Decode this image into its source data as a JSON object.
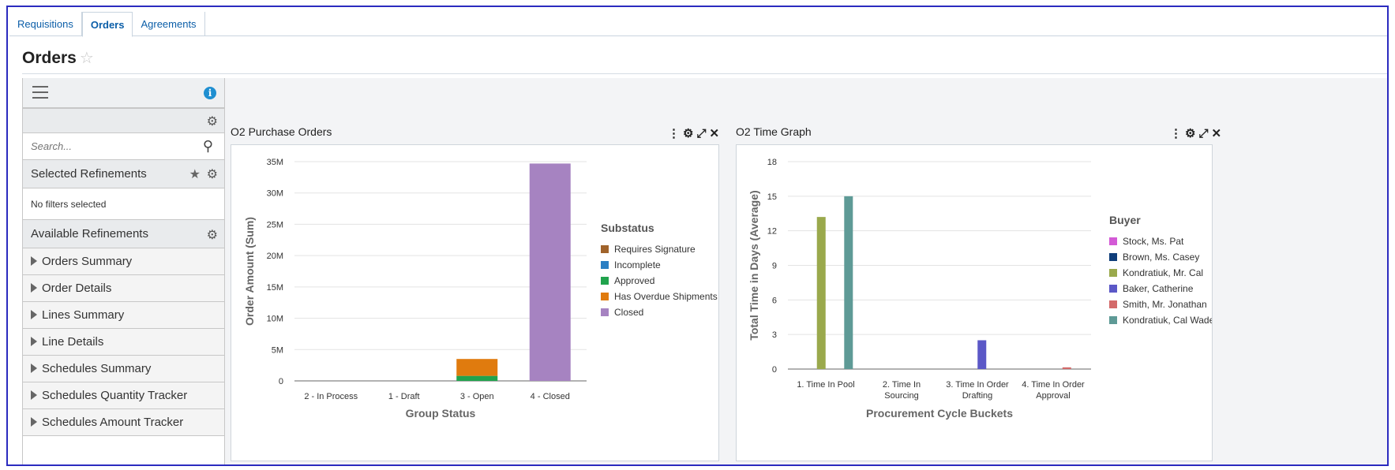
{
  "tabs": [
    "Requisitions",
    "Orders",
    "Agreements"
  ],
  "page": {
    "title": "Orders"
  },
  "sidebar": {
    "search_placeholder": "Search...",
    "selected_refinements": "Selected Refinements",
    "no_filters": "No filters selected",
    "available_refinements": "Available Refinements",
    "items": [
      "Orders Summary",
      "Order Details",
      "Lines Summary",
      "Line Details",
      "Schedules Summary",
      "Schedules Quantity Tracker",
      "Schedules Amount Tracker"
    ]
  },
  "panels": {
    "po": {
      "title": "O2 Purchase Orders"
    },
    "time": {
      "title": "O2 Time Graph"
    }
  },
  "chart_data": [
    {
      "type": "bar",
      "stacked": true,
      "title": "O2 Purchase Orders",
      "xlabel": "Group Status",
      "ylabel": "Order Amount (Sum)",
      "ylim": [
        0,
        35000000
      ],
      "yticks": [
        "0",
        "5M",
        "10M",
        "15M",
        "20M",
        "25M",
        "30M",
        "35M"
      ],
      "categories": [
        "2 - In Process",
        "1 - Draft",
        "3 - Open",
        "4 - Closed"
      ],
      "legend_title": "Substatus",
      "legend_position": "right",
      "series": [
        {
          "name": "Requires Signature",
          "color": "#a0632b",
          "values": [
            0,
            0,
            0,
            0
          ]
        },
        {
          "name": "Incomplete",
          "color": "#2a7fc3",
          "values": [
            0,
            0,
            0,
            0
          ]
        },
        {
          "name": "Approved",
          "color": "#21a34d",
          "values": [
            0,
            0,
            800000,
            0
          ]
        },
        {
          "name": "Has Overdue Shipments",
          "color": "#e07b0e",
          "values": [
            0,
            0,
            2700000,
            0
          ]
        },
        {
          "name": "Closed",
          "color": "#a683c1",
          "values": [
            0,
            0,
            0,
            34700000
          ]
        }
      ]
    },
    {
      "type": "bar",
      "title": "O2 Time Graph",
      "xlabel": "Procurement Cycle Buckets",
      "ylabel": "Total Time in Days (Average)",
      "ylim": [
        0,
        18
      ],
      "yticks": [
        "0",
        "3",
        "6",
        "9",
        "12",
        "15",
        "18"
      ],
      "categories": [
        [
          "1. Time In Pool"
        ],
        [
          "2. Time In",
          "Sourcing"
        ],
        [
          "3. Time In Order",
          "Drafting"
        ],
        [
          "4. Time In Order",
          "Approval"
        ]
      ],
      "legend_title": "Buyer",
      "legend_position": "right",
      "series": [
        {
          "name": "Stock, Ms. Pat",
          "color": "#d35ad6",
          "values": [
            0,
            0,
            0,
            0
          ]
        },
        {
          "name": "Brown, Ms. Casey",
          "color": "#0f3d7a",
          "values": [
            0,
            0,
            0,
            0
          ]
        },
        {
          "name": "Kondratiuk, Mr. Cal",
          "color": "#9aa94c",
          "values": [
            13.2,
            0,
            0,
            0
          ]
        },
        {
          "name": "Baker, Catherine",
          "color": "#5b58c7",
          "values": [
            0,
            0,
            2.5,
            0
          ]
        },
        {
          "name": "Smith, Mr. Jonathan",
          "color": "#d36a6a",
          "values": [
            0,
            0,
            0,
            0.15
          ]
        },
        {
          "name": "Kondratiuk, Cal Wade",
          "color": "#5e9a96",
          "values": [
            15,
            0,
            0,
            0
          ]
        }
      ]
    }
  ]
}
